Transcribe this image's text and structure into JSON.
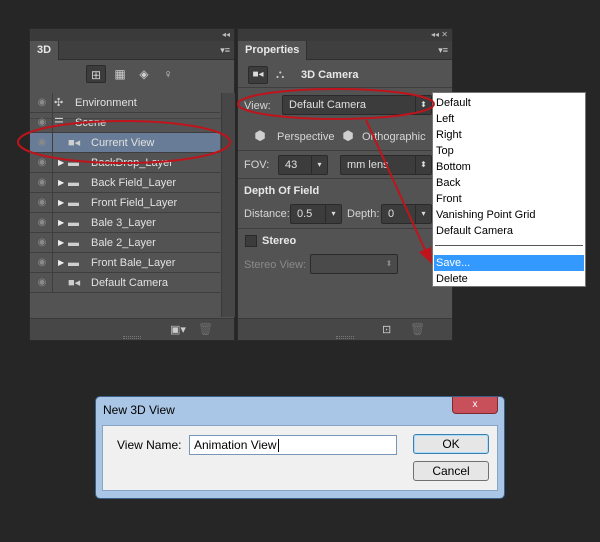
{
  "panel3d": {
    "tab": "3D",
    "layers": [
      {
        "label": "Environment",
        "icon": "environment-icon"
      },
      {
        "label": "Scene",
        "icon": "scene-icon"
      },
      {
        "label": "Current View",
        "icon": "camera-icon",
        "selected": true
      },
      {
        "label": "BackDrop_Layer",
        "icon": "folder-icon"
      },
      {
        "label": "Back Field_Layer",
        "icon": "folder-icon"
      },
      {
        "label": "Front Field_Layer",
        "icon": "folder-icon"
      },
      {
        "label": "Bale 3_Layer",
        "icon": "folder-icon"
      },
      {
        "label": "Bale 2_Layer",
        "icon": "folder-icon"
      },
      {
        "label": "Front Bale_Layer",
        "icon": "folder-icon"
      },
      {
        "label": "Default Camera",
        "icon": "camera-icon"
      }
    ]
  },
  "properties": {
    "tab": "Properties",
    "header": "3D Camera",
    "view_label": "View:",
    "view_value": "Default Camera",
    "perspective_label": "Perspective",
    "orthographic_label": "Orthographic",
    "fov_label": "FOV:",
    "fov_value": "43",
    "fov_unit": "mm lens",
    "dof_header": "Depth Of Field",
    "distance_label": "Distance:",
    "distance_value": "0.5",
    "depth_label": "Depth:",
    "depth_value": "0",
    "stereo_label": "Stereo",
    "stereo_view_label": "Stereo View:"
  },
  "dropdown": {
    "items": [
      "Default",
      "Left",
      "Right",
      "Top",
      "Bottom",
      "Back",
      "Front",
      "Vanishing Point Grid",
      "Default Camera"
    ],
    "save": "Save...",
    "delete": "Delete"
  },
  "dialog": {
    "title": "New 3D View",
    "close": "x",
    "field_label": "View Name:",
    "field_value": "Animation View",
    "ok": "OK",
    "cancel": "Cancel"
  },
  "annotation_color": "#c0141c"
}
